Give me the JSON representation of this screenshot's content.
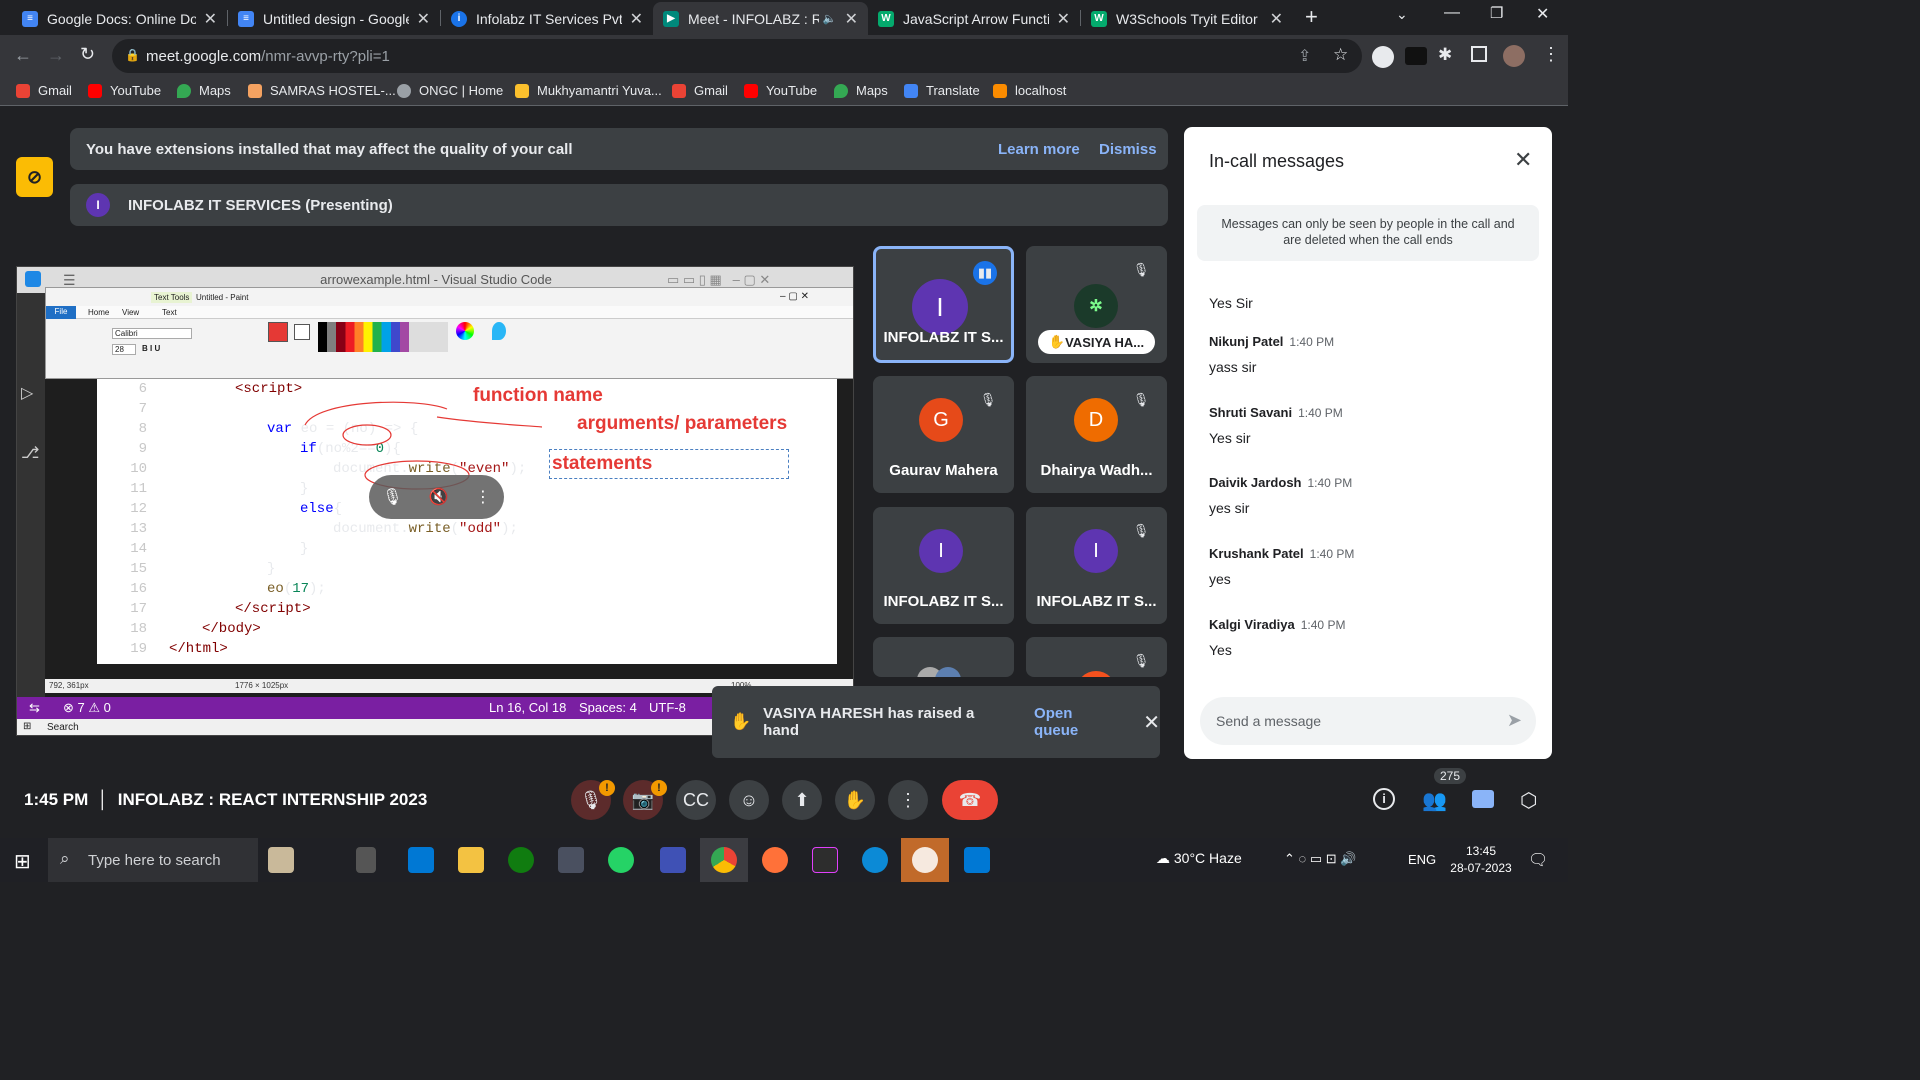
{
  "browser": {
    "tabs": [
      {
        "title": "Google Docs: Online Docum",
        "color": "#4285f4",
        "icon": "docs-icon"
      },
      {
        "title": "Untitled design - Google D",
        "color": "#4285f4",
        "icon": "docs-icon"
      },
      {
        "title": "Infolabz IT Services Pvt Ltd",
        "color": "#1a73e8",
        "icon": "infolabz-icon"
      },
      {
        "title": "Meet - INFOLABZ : REA",
        "color": "#00897b",
        "icon": "meet-icon",
        "active": true
      },
      {
        "title": "JavaScript Arrow Function",
        "color": "#04aa6d",
        "icon": "w3schools-icon"
      },
      {
        "title": "W3Schools Tryit Editor",
        "color": "#04aa6d",
        "icon": "w3schools-icon"
      }
    ],
    "url_host": "meet.google.com",
    "url_path": "/nmr-avvp-rty?pli=1",
    "bookmarks": [
      "Gmail",
      "YouTube",
      "Maps",
      "SAMRAS HOSTEL-...",
      "ONGC | Home",
      "Mukhyamantri Yuva...",
      "Gmail",
      "YouTube",
      "Maps",
      "Translate",
      "localhost"
    ]
  },
  "meet": {
    "ext_warning": "You have extensions installed that may affect the quality of your call",
    "learn_more": "Learn more",
    "dismiss": "Dismiss",
    "presenting": "INFOLABZ IT SERVICES (Presenting)",
    "presenter_initial": "I",
    "tiles": [
      {
        "name": "INFOLABZ IT S...",
        "initial": "I",
        "color": "#5e35b1"
      },
      {
        "name": "VASIYA HA...",
        "initial": "",
        "color": "#1b3a2a"
      },
      {
        "name": "Gaurav Mahera",
        "initial": "G",
        "color": "#e64a19"
      },
      {
        "name": "Dhairya Wadh...",
        "initial": "D",
        "color": "#ef6c00"
      },
      {
        "name": "INFOLABZ IT S...",
        "initial": "I",
        "color": "#5e35b1"
      },
      {
        "name": "INFOLABZ IT S...",
        "initial": "I",
        "color": "#5e35b1"
      }
    ],
    "hand_toast": "VASIYA HARESH has raised a hand",
    "open_queue": "Open queue",
    "time": "1:45 PM",
    "meeting_name": "INFOLABZ : REACT INTERNSHIP 2023",
    "participants_count": "275"
  },
  "chat": {
    "title": "In-call messages",
    "note": "Messages can only be seen by people in the call and are deleted when the call ends",
    "partial_msg": "Yes Sir",
    "messages": [
      {
        "who": "Nikunj Patel",
        "time": "1:40 PM",
        "text": "yass sir"
      },
      {
        "who": "Shruti Savani",
        "time": "1:40 PM",
        "text": "Yes sir"
      },
      {
        "who": "Daivik Jardosh",
        "time": "1:40 PM",
        "text": "yes sir"
      },
      {
        "who": "Krushank Patel",
        "time": "1:40 PM",
        "text": "yes"
      },
      {
        "who": "Kalgi Viradiya",
        "time": "1:40 PM",
        "text": "Yes"
      }
    ],
    "placeholder": "Send a message"
  },
  "shared": {
    "vscode_title": "arrowexample.html - Visual Studio Code",
    "paint_title": "Untitled - Paint",
    "paint_tabs": [
      "File",
      "Home",
      "View",
      "Text"
    ],
    "text_tools": "Text Tools",
    "font_name": "Calibri",
    "font_size": "28",
    "lines": [
      "6",
      "7",
      "8",
      "9",
      "10",
      "11",
      "12",
      "13",
      "14",
      "15",
      "16",
      "17",
      "18",
      "19"
    ],
    "ann_function_name": "function name",
    "ann_args": "arguments/ parameters",
    "ann_statements": "statements",
    "status_pos": "Ln 16, Col 18",
    "status_spaces": "Spaces: 4",
    "status_enc": "UTF-8",
    "status_errors": "7",
    "status_warn": "0",
    "paint_coords": "792, 361px",
    "paint_size": "1776 × 1025px",
    "paint_zoom": "100%",
    "win_search": "Search"
  },
  "taskbar": {
    "search_placeholder": "Type here to search",
    "weather": "30°C  Haze",
    "lang": "ENG",
    "clock_time": "13:45",
    "clock_date": "28-07-2023"
  }
}
